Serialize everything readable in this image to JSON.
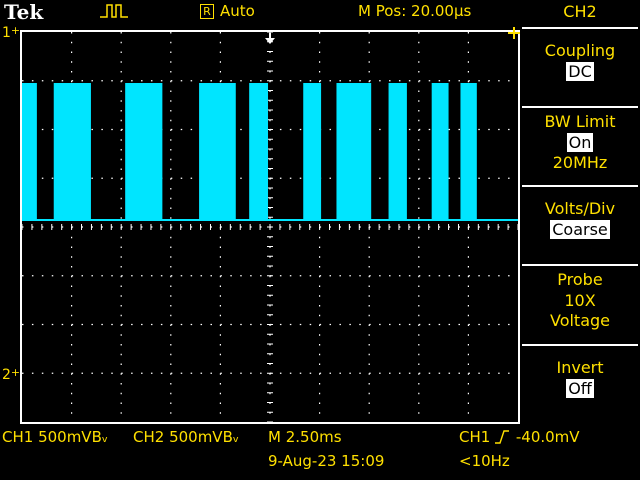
{
  "header": {
    "brand": "Tek",
    "trigger_state_badge": "R",
    "acquire_mode": "Auto",
    "position": "M Pos: 20.00µs",
    "channel_title": "CH2"
  },
  "icons": {
    "trigger_pulse": "pulse-icon",
    "trigger_position_marker": "down-arrow-marker-icon",
    "trigger_level_marker": "cross-marker-icon"
  },
  "screen": {
    "ch1_marker": "1",
    "ch2_marker": "2",
    "trace_color": "#00e5ff"
  },
  "menu": {
    "items": [
      {
        "label": "Coupling",
        "value": "DC",
        "boxed": true
      },
      {
        "label": "BW Limit",
        "value": "On",
        "boxed": true,
        "extra": "20MHz"
      },
      {
        "label": "Volts/Div",
        "value": "Coarse",
        "boxed": true
      },
      {
        "label": "Probe",
        "value": "10X",
        "boxed": false,
        "extra": "Voltage"
      },
      {
        "label": "Invert",
        "value": "Off",
        "boxed": true
      }
    ]
  },
  "footer": {
    "ch1_scale": "CH1  500mVBᵥ",
    "ch2_scale": "CH2  500mVBᵥ",
    "timebase": "M 2.50ms",
    "trigger_source": "CH1",
    "trigger_level": "-40.0mV",
    "date_time": "9-Aug-23 15:09",
    "frequency": "<10Hz"
  },
  "colors": {
    "accent": "#ffe000",
    "trace": "#00e5ff",
    "grid": "#ffffff",
    "background": "#000000"
  },
  "chart_data": {
    "type": "line",
    "series": [
      {
        "kind": "digital-pulse-train",
        "low": 0,
        "high": 1,
        "pulses": [
          [
            0,
            0.03
          ],
          [
            0.064,
            0.139
          ],
          [
            0.208,
            0.283
          ],
          [
            0.357,
            0.431
          ],
          [
            0.458,
            0.496
          ],
          [
            0.567,
            0.603
          ],
          [
            0.634,
            0.704
          ],
          [
            0.739,
            0.776
          ],
          [
            0.826,
            0.86
          ],
          [
            0.884,
            0.917
          ]
        ]
      }
    ]
  }
}
